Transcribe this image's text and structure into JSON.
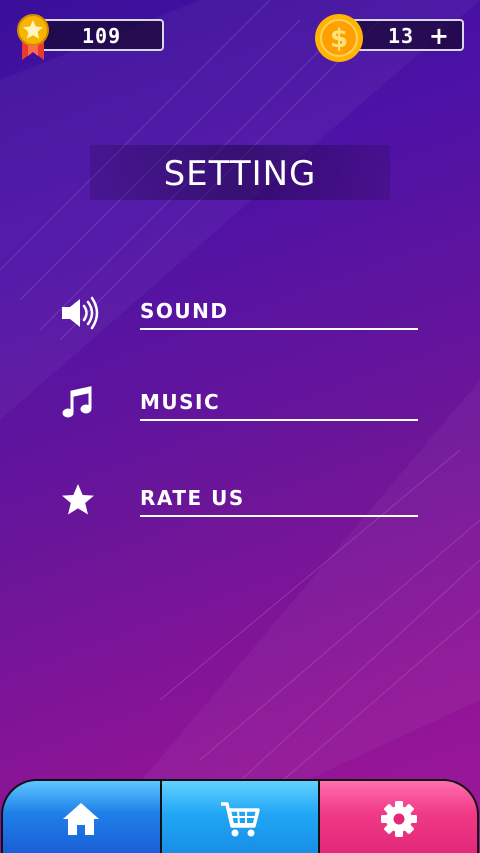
{
  "header": {
    "level_value": "109",
    "coins_value": "13",
    "coins_add_label": "+"
  },
  "title": "SETTING",
  "menu": {
    "items": [
      {
        "label": "SOUND",
        "icon": "speaker-icon"
      },
      {
        "label": "MUSIC",
        "icon": "music-note-icon"
      },
      {
        "label": "RATE US",
        "icon": "star-icon"
      }
    ]
  },
  "bottom_nav": {
    "items": [
      {
        "icon": "home-icon",
        "active": false
      },
      {
        "icon": "cart-icon",
        "active": false
      },
      {
        "icon": "gear-icon",
        "active": true
      }
    ]
  },
  "colors": {
    "background_top": "#3a0f9a",
    "background_bottom": "#a0179a",
    "nav_blue": "#1f7fe8",
    "nav_pink": "#f03a86",
    "coin_gold": "#ffb400"
  }
}
